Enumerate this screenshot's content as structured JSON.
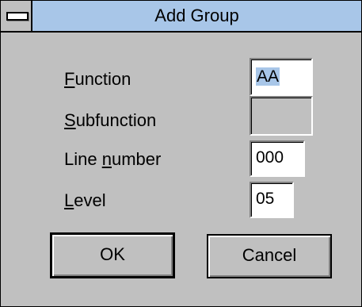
{
  "window": {
    "title": "Add Group"
  },
  "form": {
    "function": {
      "label_mnemonic": "F",
      "label_rest": "unction",
      "value": "AA"
    },
    "subfunction": {
      "label_mnemonic": "S",
      "label_rest": "ubfunction",
      "value": ""
    },
    "line_number": {
      "label_pre": "Line ",
      "label_mnemonic": "n",
      "label_rest": "umber",
      "value": "000"
    },
    "level": {
      "label_mnemonic": "L",
      "label_rest": "evel",
      "value": "05"
    }
  },
  "buttons": {
    "ok_label": "OK",
    "cancel_label": "Cancel"
  },
  "icons": {
    "system_menu": "system-menu-icon"
  },
  "colors": {
    "titlebar": "#a8c6e8",
    "dialog_bg": "#c0c0c0",
    "selection": "#a8c6e8"
  }
}
